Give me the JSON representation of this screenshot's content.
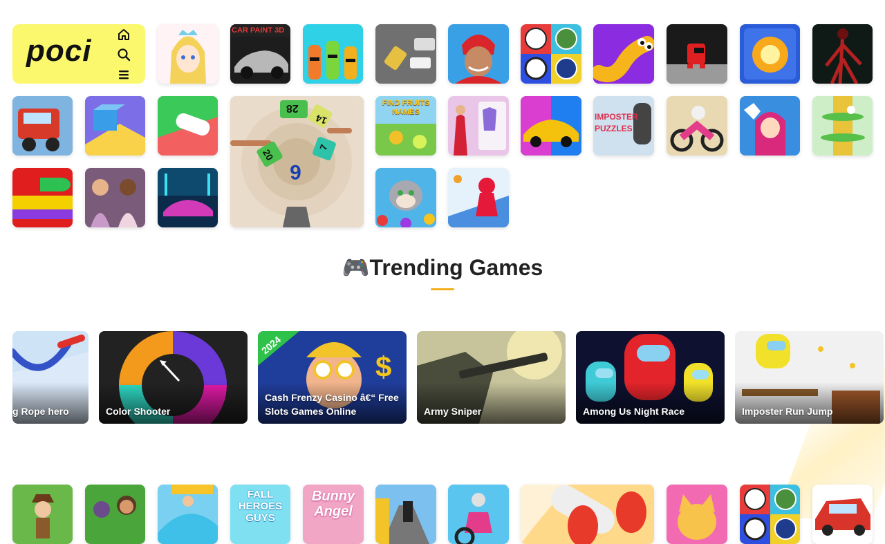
{
  "brand": {
    "logo_text": "poci"
  },
  "nav": {
    "home_icon": "home-icon",
    "search_icon": "search-icon",
    "menu_icon": "menu-icon"
  },
  "top_grid": {
    "tile_icons": [
      "princess-coloring",
      "car-paint-3d",
      "bottle-faces",
      "parking-cars",
      "football-player",
      "car-logos-quiz",
      "worm-snake",
      "pixel-impostor",
      "fire-puzzle",
      "siren-head",
      "cartoon-truck",
      "cube-slide",
      "white-car-jam",
      "helix-stack-tower",
      "find-fruits-names",
      "fashion-dressup",
      "neon-sports-car",
      "imposter-puzzles",
      "moto-rider",
      "masha-dentist",
      "stack-ball-tower",
      "color-roll",
      "fashion-girls",
      "neon-race-car",
      "tom-cat-bubbles",
      "run-race-3d"
    ],
    "car_paint_text": "CAR PAINT 3D",
    "find_fruits_text": "FIND FRUITS NAMES",
    "imposter_text": "IMPOSTER PUZZLES",
    "helix_numbers": [
      "28",
      "14",
      "20",
      "7",
      "6"
    ]
  },
  "section": {
    "emoji": "🎮",
    "title": "Trending Games"
  },
  "trending": [
    {
      "title": "Swing Rope hero",
      "visible_title": "g Rope hero"
    },
    {
      "title": "Color Shooter"
    },
    {
      "title": "Cash Frenzy Casino â€“ Free Slots Games Online",
      "badge": "2024"
    },
    {
      "title": "Army Sniper"
    },
    {
      "title": "Among Us Night Race"
    },
    {
      "title": "Imposter Run Jump"
    }
  ],
  "bottom_row": {
    "tile_icons": [
      "adventure-hat",
      "dora-boots",
      "water-slide",
      "fall-heroes-guys",
      "bunny-angel",
      "subway-runner",
      "moto-rider-2",
      "red-blob",
      "orange-cat",
      "car-logos-quiz-2",
      "red-suv"
    ],
    "fall_heroes_text": "FALL HEROES GUYS",
    "bunny_text": "Bunny Angel"
  },
  "colors": {
    "logo_bg": "#fbf86e",
    "accent": "#f2b01e",
    "title": "#222222"
  }
}
